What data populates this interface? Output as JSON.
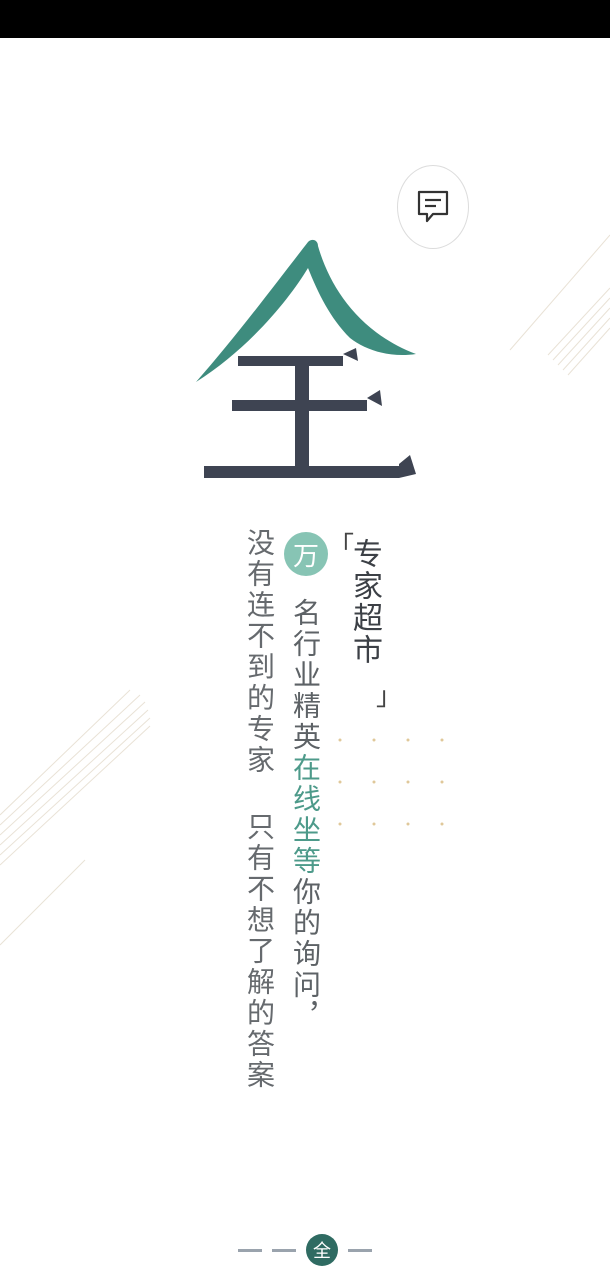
{
  "big_character": "全",
  "badge_char": "万",
  "bracket_open": "「",
  "bracket_close": "」",
  "columns": {
    "right": "专家超市",
    "middle_a": "名行业精英",
    "middle_hl": "在线坐等",
    "middle_b": "你的询问，",
    "left": "没有连不到的专家  只有不想了解的答案"
  },
  "pager": {
    "active_label": "全"
  },
  "icons": {
    "message": "chat-bubble-icon"
  },
  "colors": {
    "accent": "#4d9a8a",
    "dark": "#3e4452",
    "pager_active": "#2f6b62"
  }
}
